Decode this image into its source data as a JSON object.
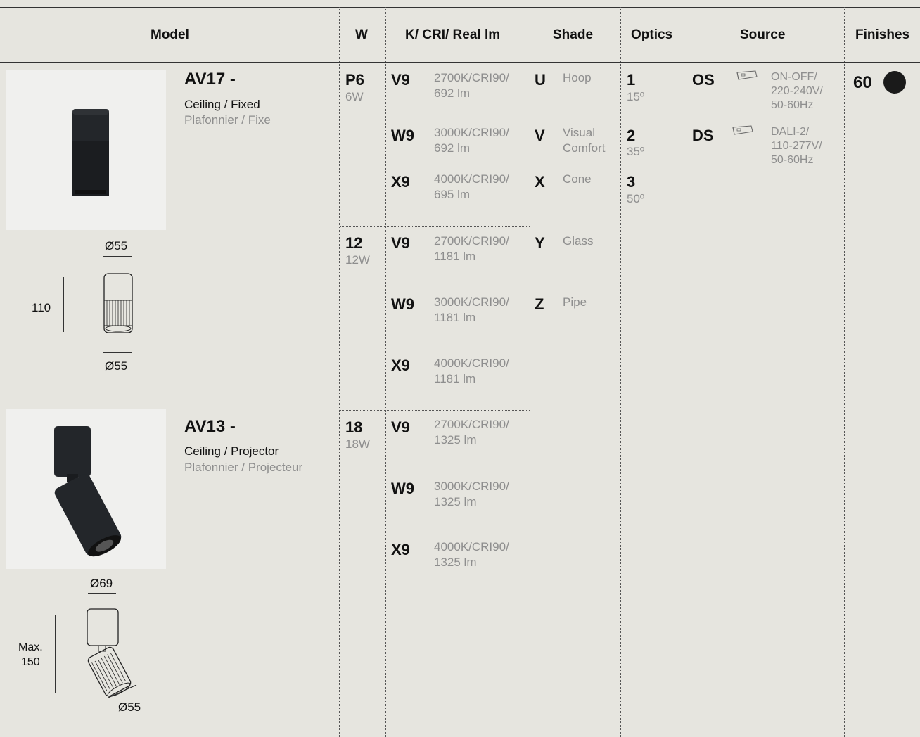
{
  "header": {
    "model": "Model",
    "w": "W",
    "kcri": "K/ CRI/ Real lm",
    "shade": "Shade",
    "optics": "Optics",
    "source": "Source",
    "finishes": "Finishes"
  },
  "models": [
    {
      "code": "AV17 -",
      "name": "Ceiling / Fixed",
      "name_fr": "Plafonnier / Fixe",
      "dim_top": "Ø55",
      "dim_height": "110",
      "dim_bottom": "Ø55"
    },
    {
      "code": "AV13 -",
      "name": "Ceiling / Projector",
      "name_fr": "Plafonnier / Projecteur",
      "dim_top": "Ø69",
      "dim_height": "Max.\n150",
      "dim_bottom": "Ø55"
    }
  ],
  "watts": [
    {
      "code": "P6",
      "sub": "6W"
    },
    {
      "code": "12",
      "sub": "12W"
    },
    {
      "code": "18",
      "sub": "18W"
    }
  ],
  "kcri": [
    {
      "code": "V9",
      "desc": "2700K/CRI90/\n692 lm"
    },
    {
      "code": "W9",
      "desc": "3000K/CRI90/\n692 lm"
    },
    {
      "code": "X9",
      "desc": "4000K/CRI90/\n695 lm"
    },
    {
      "code": "V9",
      "desc": "2700K/CRI90/\n1181 lm"
    },
    {
      "code": "W9",
      "desc": "3000K/CRI90/\n1181 lm"
    },
    {
      "code": "X9",
      "desc": "4000K/CRI90/\n1181 lm"
    },
    {
      "code": "V9",
      "desc": "2700K/CRI90/\n1325 lm"
    },
    {
      "code": "W9",
      "desc": "3000K/CRI90/\n1325 lm"
    },
    {
      "code": "X9",
      "desc": "4000K/CRI90/\n1325 lm"
    }
  ],
  "shades": [
    {
      "code": "U",
      "desc": "Hoop"
    },
    {
      "code": "V",
      "desc": "Visual\nComfort"
    },
    {
      "code": "X",
      "desc": "Cone"
    },
    {
      "code": "Y",
      "desc": "Glass"
    },
    {
      "code": "Z",
      "desc": "Pipe"
    }
  ],
  "optics": [
    {
      "code": "1",
      "sub": "15º"
    },
    {
      "code": "2",
      "sub": "35º"
    },
    {
      "code": "3",
      "sub": "50º"
    }
  ],
  "sources": [
    {
      "code": "OS",
      "desc": "ON-OFF/\n220-240V/\n50-60Hz",
      "icon": "driver-icon"
    },
    {
      "code": "DS",
      "desc": "DALI-2/\n110-277V/\n50-60Hz",
      "icon": "driver-icon"
    }
  ],
  "finishes": [
    {
      "code": "60",
      "color": "#1a1a1a"
    }
  ],
  "colors": {
    "background": "#e6e5df",
    "text": "#111111",
    "muted": "#8e8e8e",
    "product": "#23262a"
  }
}
